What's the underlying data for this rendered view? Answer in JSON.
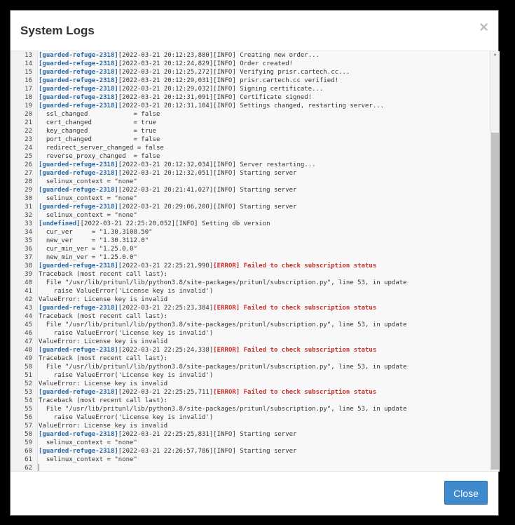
{
  "modal": {
    "title": "System Logs",
    "close_icon": "×",
    "close_button_label": "Close"
  },
  "colors": {
    "host_tag": "#2b6aa8",
    "error_tag": "#c9302c",
    "button": "#3e8acc"
  },
  "log_lines": [
    {
      "n": "13",
      "host": "[guarded-refuge-2318]",
      "text": "[2022-03-21 20:12:23,880][INFO] Creating new order..."
    },
    {
      "n": "14",
      "host": "[guarded-refuge-2318]",
      "text": "[2022-03-21 20:12:24,829][INFO] Order created!"
    },
    {
      "n": "15",
      "host": "[guarded-refuge-2318]",
      "text": "[2022-03-21 20:12:25,272][INFO] Verifying prisr.cartech.cc..."
    },
    {
      "n": "16",
      "host": "[guarded-refuge-2318]",
      "text": "[2022-03-21 20:12:29,031][INFO] prisr.cartech.cc verified!"
    },
    {
      "n": "17",
      "host": "[guarded-refuge-2318]",
      "text": "[2022-03-21 20:12:29,032][INFO] Signing certificate..."
    },
    {
      "n": "18",
      "host": "[guarded-refuge-2318]",
      "text": "[2022-03-21 20:12:31,091][INFO] Certificate signed!"
    },
    {
      "n": "19",
      "host": "[guarded-refuge-2318]",
      "text": "[2022-03-21 20:12:31,104][INFO] Settings changed, restarting server..."
    },
    {
      "n": "20",
      "text": "  ssl_changed            = false"
    },
    {
      "n": "21",
      "text": "  cert_changed           = true"
    },
    {
      "n": "22",
      "text": "  key_changed            = true"
    },
    {
      "n": "23",
      "text": "  port_changed           = false"
    },
    {
      "n": "24",
      "text": "  redirect_server_changed = false"
    },
    {
      "n": "25",
      "text": "  reverse_proxy_changed  = false"
    },
    {
      "n": "26",
      "host": "[guarded-refuge-2318]",
      "text": "[2022-03-21 20:12:32,034][INFO] Server restarting..."
    },
    {
      "n": "27",
      "host": "[guarded-refuge-2318]",
      "text": "[2022-03-21 20:12:32,051][INFO] Starting server"
    },
    {
      "n": "28",
      "text": "  selinux_context = \"none\""
    },
    {
      "n": "29",
      "host": "[guarded-refuge-2318]",
      "text": "[2022-03-21 20:21:41,027][INFO] Starting server"
    },
    {
      "n": "30",
      "text": "  selinux_context = \"none\""
    },
    {
      "n": "31",
      "host": "[guarded-refuge-2318]",
      "text": "[2022-03-21 20:29:06,200][INFO] Starting server"
    },
    {
      "n": "32",
      "text": "  selinux_context = \"none\""
    },
    {
      "n": "33",
      "host": "[undefined]",
      "text": "[2022-03-21 22:25:20,052][INFO] Setting db version"
    },
    {
      "n": "34",
      "text": "  cur_ver     = \"1.30.3108.50\""
    },
    {
      "n": "35",
      "text": "  new_ver     = \"1.30.3112.0\""
    },
    {
      "n": "36",
      "text": "  cur_min_ver = \"1.25.0.0\""
    },
    {
      "n": "37",
      "text": "  new_min_ver = \"1.25.0.0\""
    },
    {
      "n": "38",
      "host": "[guarded-refuge-2318]",
      "text": "[2022-03-21 22:25:21,990]",
      "err": "[ERROR] Failed to check subscription status"
    },
    {
      "n": "39",
      "text": "Traceback (most recent call last):"
    },
    {
      "n": "40",
      "text": "  File \"/usr/lib/pritunl/lib/python3.8/site-packages/pritunl/subscription.py\", line 53, in update"
    },
    {
      "n": "41",
      "text": "    raise ValueError('License key is invalid')"
    },
    {
      "n": "42",
      "text": "ValueError: License key is invalid"
    },
    {
      "n": "43",
      "host": "[guarded-refuge-2318]",
      "text": "[2022-03-21 22:25:23,384]",
      "err": "[ERROR] Failed to check subscription status"
    },
    {
      "n": "44",
      "text": "Traceback (most recent call last):"
    },
    {
      "n": "45",
      "text": "  File \"/usr/lib/pritunl/lib/python3.8/site-packages/pritunl/subscription.py\", line 53, in update"
    },
    {
      "n": "46",
      "text": "    raise ValueError('License key is invalid')"
    },
    {
      "n": "47",
      "text": "ValueError: License key is invalid"
    },
    {
      "n": "48",
      "host": "[guarded-refuge-2318]",
      "text": "[2022-03-21 22:25:24,338]",
      "err": "[ERROR] Failed to check subscription status"
    },
    {
      "n": "49",
      "text": "Traceback (most recent call last):"
    },
    {
      "n": "50",
      "text": "  File \"/usr/lib/pritunl/lib/python3.8/site-packages/pritunl/subscription.py\", line 53, in update"
    },
    {
      "n": "51",
      "text": "    raise ValueError('License key is invalid')"
    },
    {
      "n": "52",
      "text": "ValueError: License key is invalid"
    },
    {
      "n": "53",
      "host": "[guarded-refuge-2318]",
      "text": "[2022-03-21 22:25:25,711]",
      "err": "[ERROR] Failed to check subscription status"
    },
    {
      "n": "54",
      "text": "Traceback (most recent call last):"
    },
    {
      "n": "55",
      "text": "  File \"/usr/lib/pritunl/lib/python3.8/site-packages/pritunl/subscription.py\", line 53, in update"
    },
    {
      "n": "56",
      "text": "    raise ValueError('License key is invalid')"
    },
    {
      "n": "57",
      "text": "ValueError: License key is invalid"
    },
    {
      "n": "58",
      "host": "[guarded-refuge-2318]",
      "text": "[2022-03-21 22:25:25,831][INFO] Starting server"
    },
    {
      "n": "59",
      "text": "  selinux_context = \"none\""
    },
    {
      "n": "60",
      "host": "[guarded-refuge-2318]",
      "text": "[2022-03-21 22:26:57,786][INFO] Starting server"
    },
    {
      "n": "61",
      "text": "  selinux_context = \"none\""
    },
    {
      "n": "62",
      "text": "",
      "cursor": true
    }
  ]
}
